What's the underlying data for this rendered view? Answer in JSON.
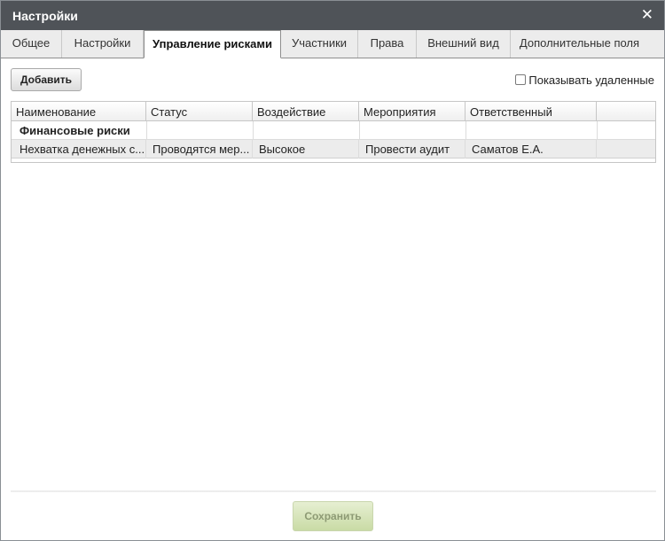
{
  "window": {
    "title": "Настройки",
    "close_icon": "✕"
  },
  "tabs": [
    {
      "label": "Общее",
      "active": false
    },
    {
      "label": "Настройки",
      "active": false
    },
    {
      "label": "Управление рисками",
      "active": true
    },
    {
      "label": "Участники",
      "active": false
    },
    {
      "label": "Права",
      "active": false
    },
    {
      "label": "Внешний вид",
      "active": false
    },
    {
      "label": "Дополнительные поля",
      "active": false
    }
  ],
  "toolbar": {
    "add_label": "Добавить",
    "show_deleted_label": "Показывать удаленные",
    "show_deleted_checked": false
  },
  "grid": {
    "columns": [
      "Наименование",
      "Статус",
      "Воздействие",
      "Мероприятия",
      "Ответственный"
    ],
    "groups": [
      {
        "title": "Финансовые риски",
        "rows": [
          [
            "Нехватка денежных с...",
            "Проводятся мер...",
            "Высокое",
            "Провести аудит",
            "Саматов Е.А."
          ]
        ]
      }
    ]
  },
  "footer": {
    "save_label": "Сохранить"
  }
}
